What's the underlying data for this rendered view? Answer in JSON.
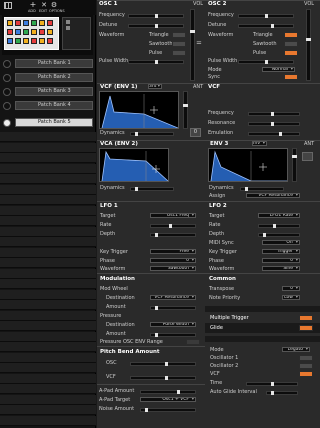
{
  "toolbar": {
    "add": "ADD",
    "edit": "EDIT",
    "options": "OPTIONS"
  },
  "banks": [
    "Patch Bank 1",
    "Patch Bank 2",
    "Patch Bank 3",
    "Patch Bank 4",
    "Patch Bank 5"
  ],
  "osc1": {
    "title": "OSC 1",
    "vol": "VOL",
    "frequency": "Frequency",
    "detune": "Detune",
    "waveform": "Waveform",
    "triangle": "Triangle",
    "sawtooth": "Sawtooth",
    "pulse": "Pulse",
    "pulse_width": "Pulse Width"
  },
  "osc2": {
    "title": "OSC 2",
    "vol": "VOL",
    "frequency": "Frequency",
    "detune": "Detune",
    "waveform": "Waveform",
    "triangle": "Triangle",
    "sawtooth": "Sawtooth",
    "pulse": "Pulse",
    "pulse_width": "Pulse Width",
    "mode": "Mode",
    "mode_value": "Normal",
    "sync": "Sync"
  },
  "vcf_env": {
    "title": "VCF (ENV 1)",
    "rate": "3rd",
    "ant": "ANT",
    "dynamics": "Dynamics",
    "amount": "0"
  },
  "vcf": {
    "title": "VCF",
    "frequency": "Frequency",
    "resonance": "Resonance",
    "emulation": "Emulation"
  },
  "vca": {
    "title": "VCA (ENV 2)",
    "dynamics": "Dynamics"
  },
  "env3": {
    "title": "ENV 3",
    "rate": "Inv",
    "ant": "ANT",
    "dynamics": "Dynamics",
    "assign": "Assign",
    "assign_value": "VCF Resonance"
  },
  "lfo1": {
    "title": "LFO 1",
    "target": "Target",
    "target_value": "Osc1 Freq",
    "rate": "Rate",
    "depth": "Depth",
    "key_trigger": "Key Trigger",
    "key_trigger_value": "Free",
    "phase": "Phase",
    "phase_value": "0",
    "waveform": "Waveform",
    "waveform_value": "Sawtooth"
  },
  "lfo2": {
    "title": "LFO 2",
    "target": "Target",
    "target_value": "LFO1 Rate",
    "rate": "Rate",
    "depth": "Depth",
    "midi_sync": "MIDI Sync",
    "midi_sync_value": "Off",
    "key_trigger": "Key Trigger",
    "key_trigger_value": "Trigger",
    "phase": "Phase",
    "phase_value": "0",
    "waveform": "Waveform",
    "waveform_value": "Sine"
  },
  "modulation": {
    "title": "Modulation",
    "mod_wheel": "Mod Wheel",
    "destination": "Destination",
    "destination_value": "VCF Resonance",
    "amount": "Amount",
    "pressure": "Pressure",
    "pressure_dest": "Destination",
    "pressure_dest_value": "Pulse Width",
    "pressure_amount": "Amount",
    "pressure_to": "Pressure OSC ENV Range"
  },
  "common": {
    "title": "Common",
    "transpose": "Transpose",
    "transpose_value": "0",
    "note_priority": "Note Priority",
    "note_priority_value": "Low",
    "multiple_trigger": "Multiple Trigger",
    "glide": "Glide",
    "mode": "Mode",
    "mode_value": "Legato",
    "oscillator1": "Oscillator 1",
    "oscillator2": "Oscillator 2",
    "vcf": "VCF",
    "time": "Time",
    "auto_glide": "Auto Glide Interval"
  },
  "pitchbend": {
    "title": "Pitch Bend Amount",
    "osc": "OSC",
    "vcf": "VCF"
  },
  "atouch": {
    "amount": "A-Pad Amount",
    "target": "A-Pad Target",
    "target_value": "Osc1 + VCF",
    "noise": "Noise Amount"
  },
  "colors": {
    "accent": "#e8782f",
    "panel": "#2a2a2a",
    "bank_active": "#d9d9d9"
  }
}
